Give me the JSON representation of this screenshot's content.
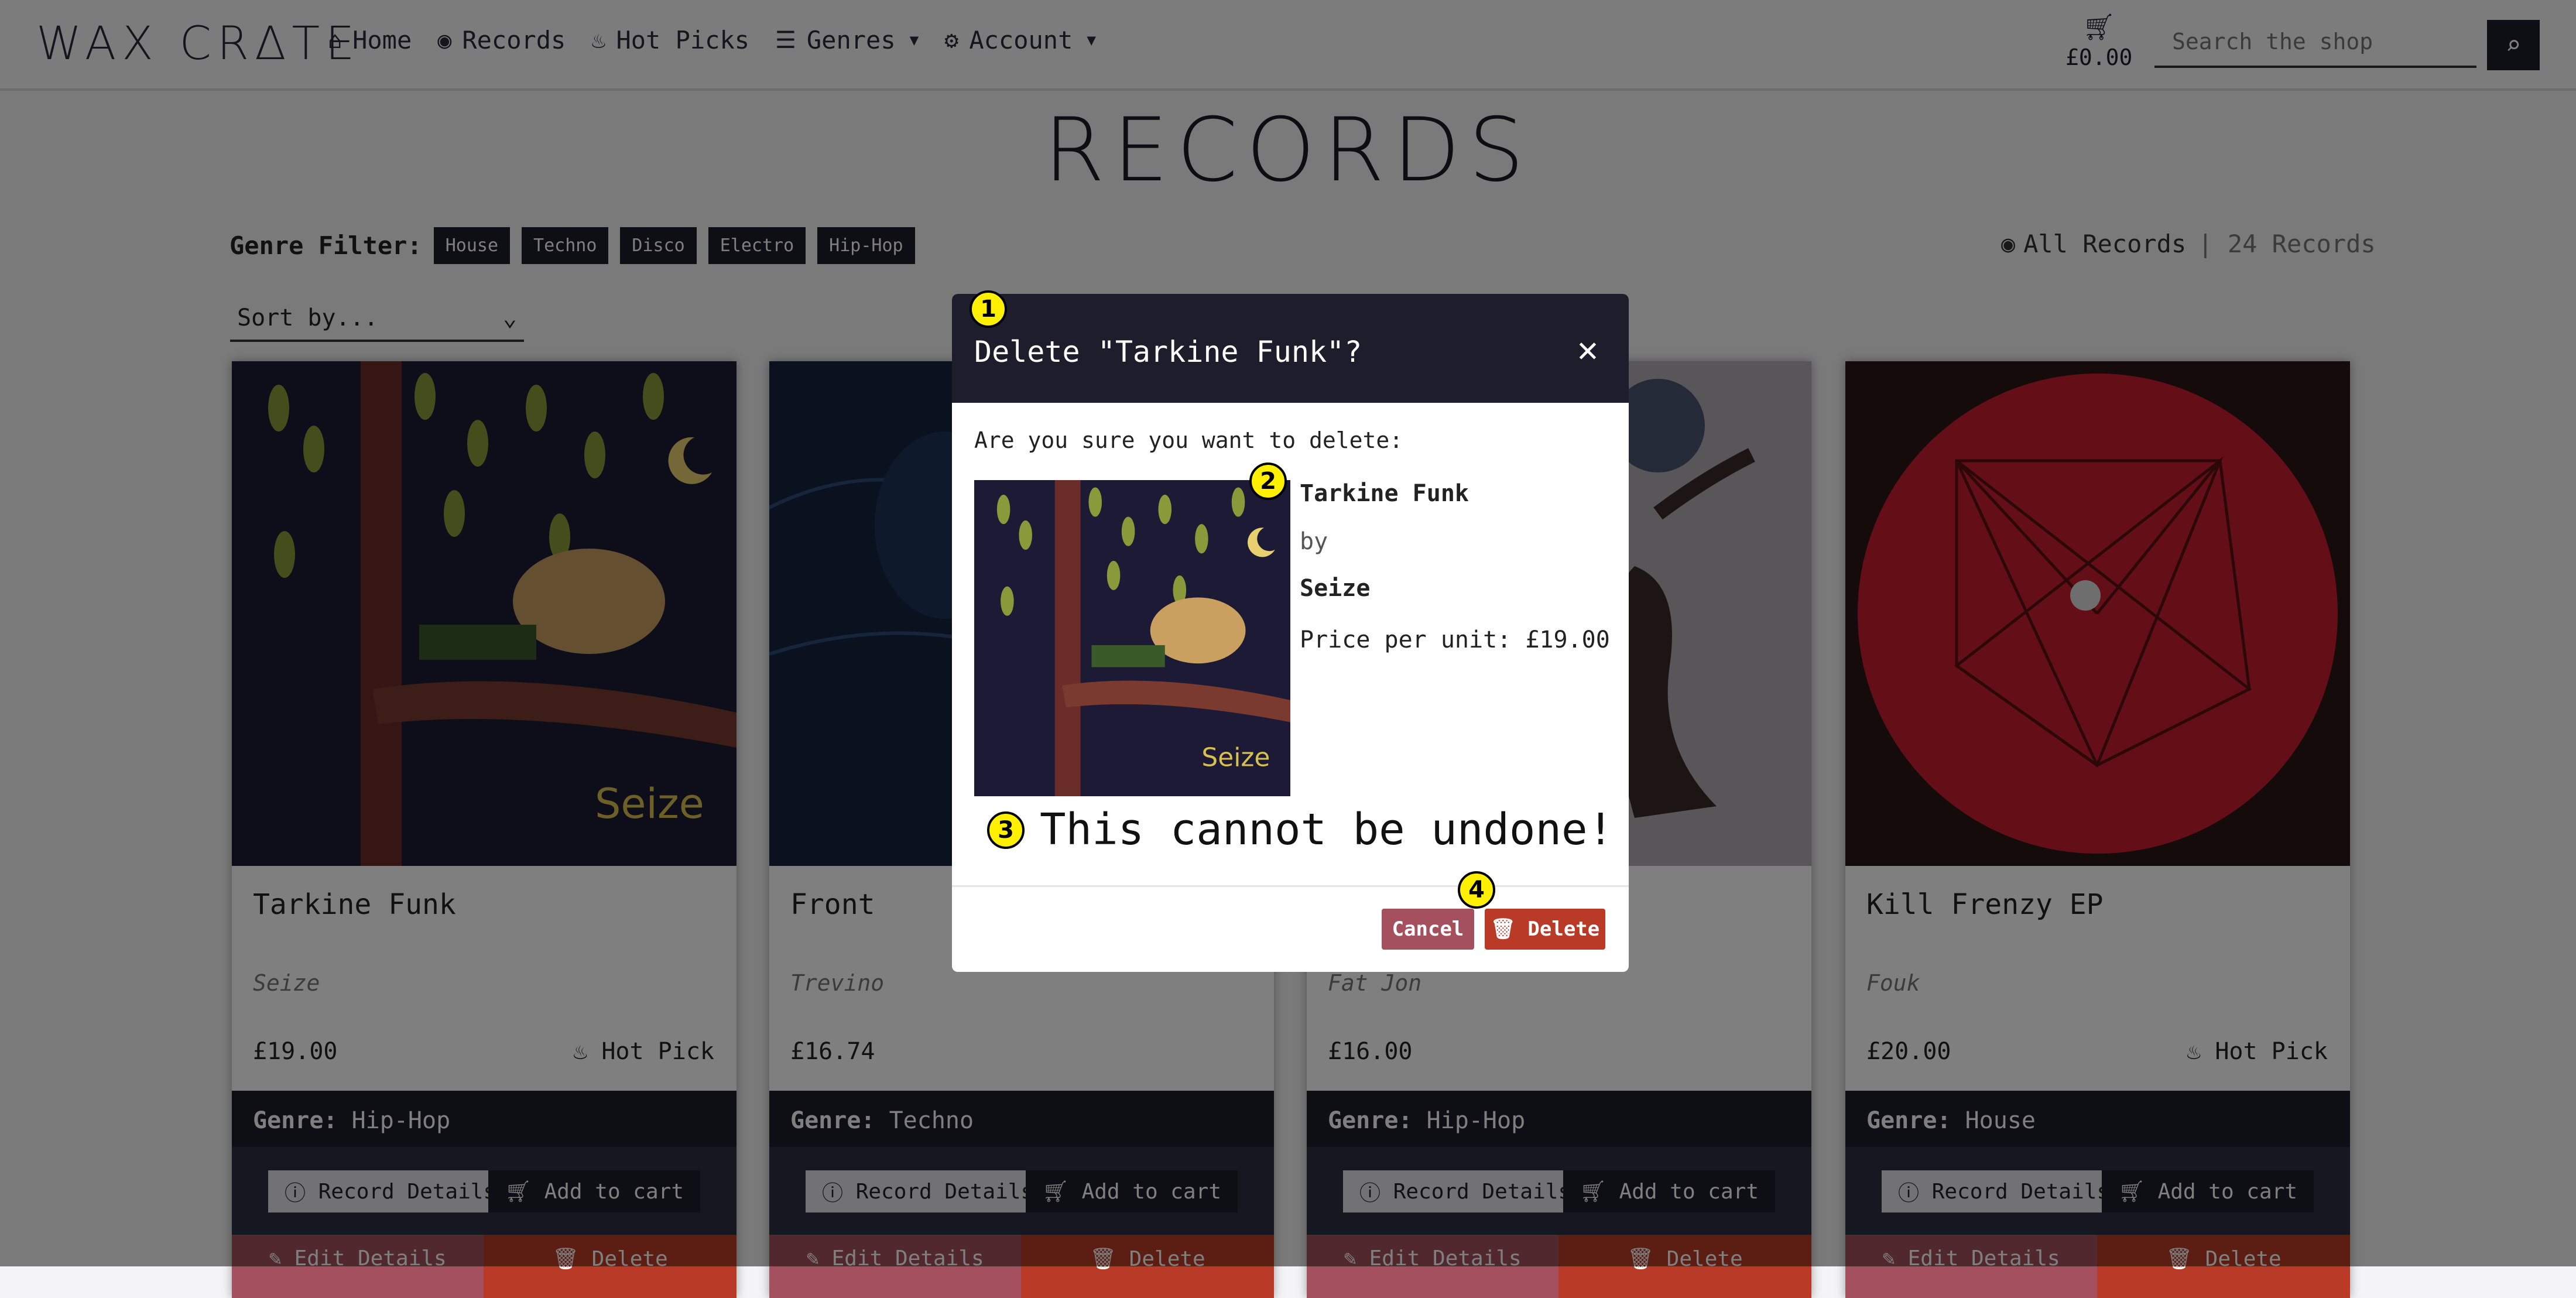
{
  "navbar": {
    "brand": "WAX CRΔTE",
    "links": [
      {
        "icon": "home-icon",
        "label": "Home"
      },
      {
        "icon": "record-icon",
        "label": "Records"
      },
      {
        "icon": "fire-icon",
        "label": "Hot Picks"
      },
      {
        "icon": "list-icon",
        "label": "Genres"
      },
      {
        "icon": "user-gear-icon",
        "label": "Account"
      }
    ],
    "cart_total": "£0.00",
    "search_placeholder": "Search the shop"
  },
  "page": {
    "title": "RECORDS",
    "genre_filter_label": "Genre Filter:",
    "genre_chips": [
      "House",
      "Techno",
      "Disco",
      "Electro",
      "Hip-Hop"
    ],
    "all_records_label": "All Records",
    "record_count": "| 24 Records",
    "sort_label": "Sort by..."
  },
  "cards": [
    {
      "title": "Tarkine Funk",
      "artist": "Seize",
      "price": "£19.00",
      "hot_pick": "Hot Pick",
      "genre_label": "Genre:",
      "genre": "Hip-Hop"
    },
    {
      "title": "Front",
      "artist": "Trevino",
      "price": "£16.74",
      "hot_pick": "",
      "genre_label": "Genre:",
      "genre": "Techno"
    },
    {
      "title": "",
      "artist": "Fat Jon",
      "price": "£16.00",
      "hot_pick": "",
      "genre_label": "Genre:",
      "genre": "Hip-Hop"
    },
    {
      "title": "Kill Frenzy EP",
      "artist": "Fouk",
      "price": "£20.00",
      "hot_pick": "Hot Pick",
      "genre_label": "Genre:",
      "genre": "House"
    }
  ],
  "card_actions": {
    "details": "Record Details",
    "add_to_cart": "Add to cart",
    "edit": "Edit Details",
    "delete": "Delete"
  },
  "modal": {
    "title": "Delete \"Tarkine Funk\"?",
    "prompt": "Are you sure you want to delete:",
    "record_title": "Tarkine Funk",
    "by": "by",
    "artist": "Seize",
    "price": "Price per unit: £19.00",
    "warning": "This cannot be undone!",
    "cancel": "Cancel",
    "delete": "Delete"
  },
  "markers": [
    "1",
    "2",
    "3",
    "4"
  ],
  "colors": {
    "dark": "#1d1d2b",
    "danger": "#b93a27",
    "cancel": "#a4505e",
    "marker": "#ffef00"
  }
}
